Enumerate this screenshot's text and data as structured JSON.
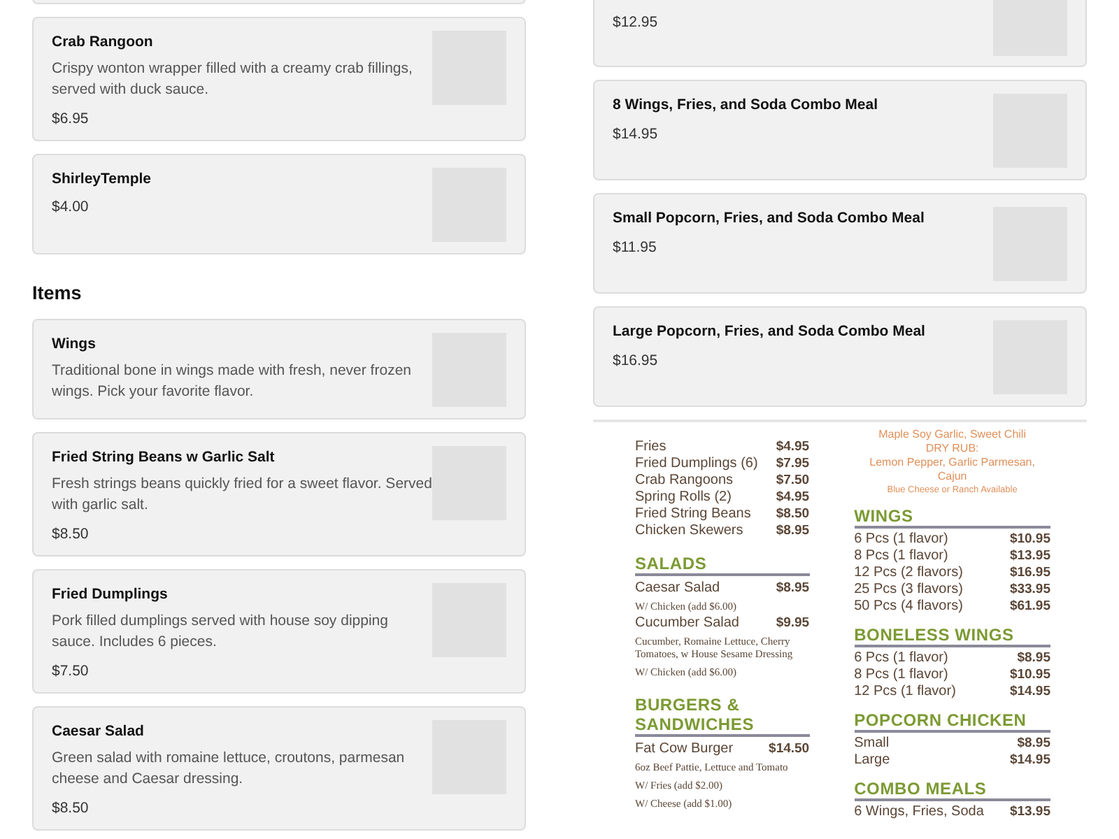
{
  "left_column": {
    "cards": [
      {
        "name": "Crab Rangoon",
        "description": "Crispy wonton wrapper filled with a creamy crab fillings, served with duck sauce.",
        "price": "$6.95"
      },
      {
        "name": "ShirleyTemple",
        "price": "$4.00"
      }
    ],
    "section_title": "Items",
    "items": [
      {
        "name": "Wings",
        "description": "Traditional bone in wings made with fresh, never frozen wings. Pick your favorite flavor."
      },
      {
        "name": "Fried String Beans w Garlic Salt",
        "description": "Fresh strings beans quickly fried for a sweet flavor. Served with garlic salt.",
        "price": "$8.50"
      },
      {
        "name": "Fried Dumplings",
        "description": "Pork filled dumplings served with house soy dipping sauce. Includes 6 pieces.",
        "price": "$7.50"
      },
      {
        "name": "Caesar Salad",
        "description": "Green salad with romaine lettuce, croutons, parmesan cheese and Caesar dressing.",
        "price": "$8.50"
      }
    ]
  },
  "right_column": {
    "cut_card": {
      "price": "$12.95"
    },
    "cards": [
      {
        "name": "8 Wings, Fries, and Soda Combo Meal",
        "price": "$14.95"
      },
      {
        "name": "Small Popcorn, Fries, and Soda Combo Meal",
        "price": "$11.95"
      },
      {
        "name": "Large Popcorn, Fries, and Soda Combo Meal",
        "price": "$16.95"
      }
    ],
    "menu_image": {
      "left": [
        {
          "kind": "row",
          "name": "Fries",
          "price": "$4.95"
        },
        {
          "kind": "row",
          "name": "Fried Dumplings (6)",
          "price": "$7.95"
        },
        {
          "kind": "row",
          "name": "Crab Rangoons",
          "price": "$7.50"
        },
        {
          "kind": "row",
          "name": "Spring Rolls (2)",
          "price": "$4.95"
        },
        {
          "kind": "row",
          "name": "Fried String Beans",
          "price": "$8.50"
        },
        {
          "kind": "row",
          "name": "Chicken Skewers",
          "price": "$8.95"
        },
        {
          "kind": "heading",
          "text": "SALADS"
        },
        {
          "kind": "row",
          "name": "Caesar Salad",
          "price": "$8.95"
        },
        {
          "kind": "note",
          "text": "W/ Chicken (add $6.00)"
        },
        {
          "kind": "row",
          "name": "Cucumber Salad",
          "price": "$9.95"
        },
        {
          "kind": "note",
          "text": "Cucumber, Romaine Lettuce, Cherry Tomatoes, w House Sesame Dressing"
        },
        {
          "kind": "note",
          "text": "W/ Chicken (add $6.00)"
        },
        {
          "kind": "heading",
          "text": "BURGERS & SANDWICHES"
        },
        {
          "kind": "row",
          "name": "Fat Cow Burger",
          "price": "$14.50"
        },
        {
          "kind": "note",
          "text": "6oz Beef Pattie, Lettuce and Tomato"
        },
        {
          "kind": "note",
          "text": "W/ Fries (add $2.00)"
        },
        {
          "kind": "note",
          "text": "W/ Cheese (add $1.00)"
        }
      ],
      "right": [
        {
          "kind": "flavor",
          "text": "Maple Soy Garlic, Sweet Chili"
        },
        {
          "kind": "flavor",
          "text": "DRY RUB:"
        },
        {
          "kind": "flavor",
          "text": "Lemon Pepper, Garlic Parmesan, Cajun"
        },
        {
          "kind": "flavor_small",
          "text": "Blue Cheese or Ranch Available"
        },
        {
          "kind": "heading",
          "text": "WINGS"
        },
        {
          "kind": "row",
          "name": "6 Pcs (1 flavor)",
          "price": "$10.95"
        },
        {
          "kind": "row",
          "name": "8 Pcs (1 flavor)",
          "price": "$13.95"
        },
        {
          "kind": "row",
          "name": "12 Pcs (2 flavors)",
          "price": "$16.95"
        },
        {
          "kind": "row",
          "name": "25 Pcs (3 flavors)",
          "price": "$33.95"
        },
        {
          "kind": "row",
          "name": "50 Pcs (4 flavors)",
          "price": "$61.95"
        },
        {
          "kind": "heading",
          "text": "BONELESS WINGS"
        },
        {
          "kind": "row",
          "name": "6 Pcs (1 flavor)",
          "price": "$8.95"
        },
        {
          "kind": "row",
          "name": "8 Pcs (1 flavor)",
          "price": "$10.95"
        },
        {
          "kind": "row",
          "name": "12 Pcs (1 flavor)",
          "price": "$14.95"
        },
        {
          "kind": "heading",
          "text": "POPCORN CHICKEN"
        },
        {
          "kind": "row",
          "name": "Small",
          "price": "$8.95"
        },
        {
          "kind": "row",
          "name": "Large",
          "price": "$14.95"
        },
        {
          "kind": "heading",
          "text": "COMBO MEALS"
        },
        {
          "kind": "row",
          "name": "6 Wings, Fries, Soda",
          "price": "$13.95"
        }
      ]
    }
  }
}
